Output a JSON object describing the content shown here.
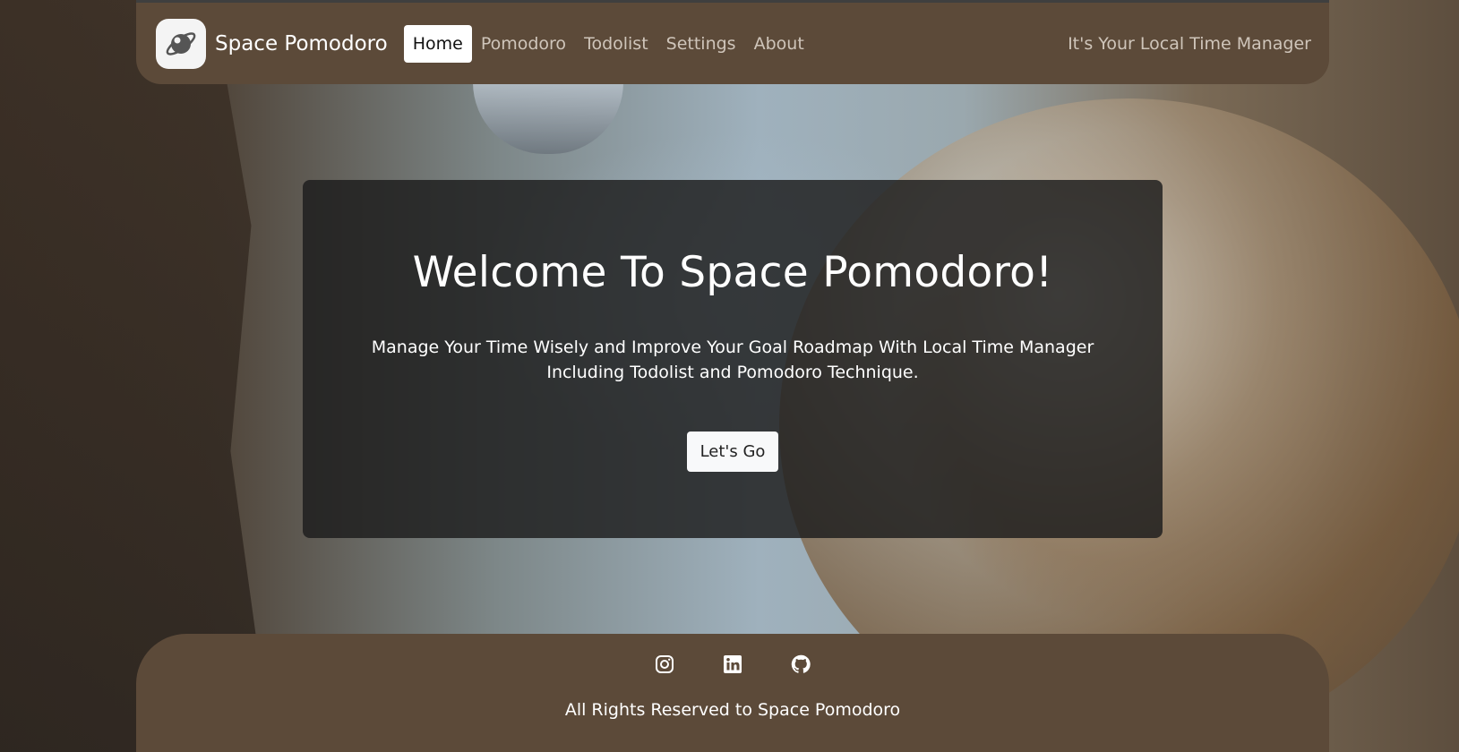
{
  "header": {
    "brand_name": "Space Pomodoro",
    "nav": [
      {
        "label": "Home",
        "active": true
      },
      {
        "label": "Pomodoro",
        "active": false
      },
      {
        "label": "Todolist",
        "active": false
      },
      {
        "label": "Settings",
        "active": false
      },
      {
        "label": "About",
        "active": false
      }
    ],
    "tagline": "It's Your Local Time Manager"
  },
  "hero": {
    "title": "Welcome To Space Pomodoro!",
    "text_line1": "Manage Your Time Wisely and Improve Your Goal Roadmap With Local Time Manager",
    "text_line2": "Including Todolist and Pomodoro Technique.",
    "button_label": "Let's Go"
  },
  "footer": {
    "socials": [
      "instagram-icon",
      "linkedin-icon",
      "github-icon"
    ],
    "copyright": "All Rights Reserved to Space Pomodoro"
  },
  "colors": {
    "bar_background": "#5c4a39",
    "hero_overlay": "#1c1c1c",
    "nav_inactive_text": "#cfc5ba"
  }
}
